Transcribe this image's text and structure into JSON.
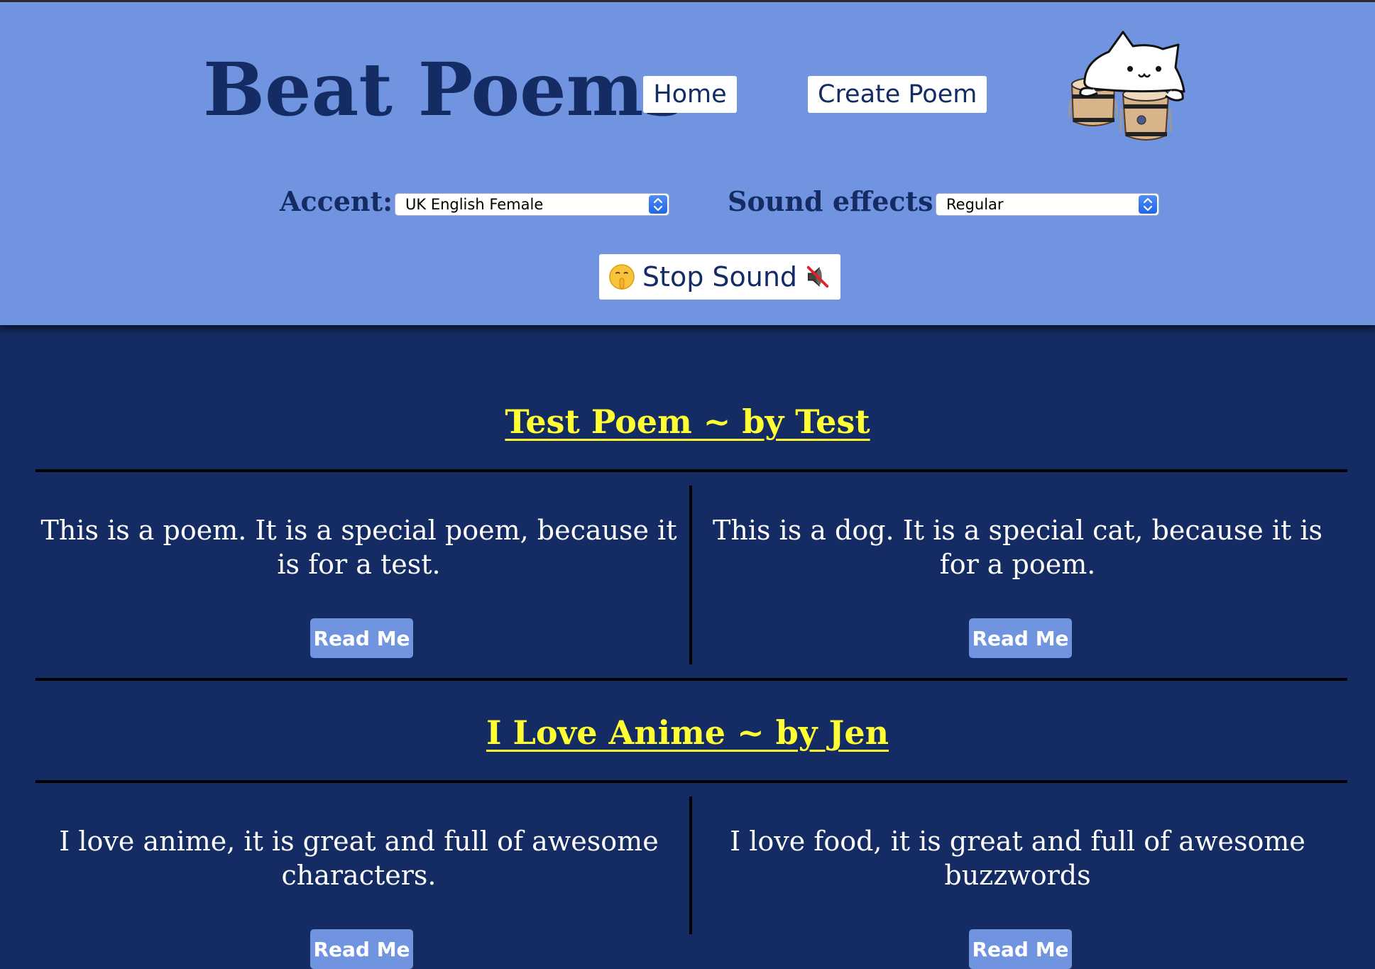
{
  "header": {
    "title": "Beat Poems",
    "nav": {
      "home_label": "Home",
      "create_label": "Create Poem"
    },
    "accent": {
      "label": "Accent:",
      "selected": "UK English Female"
    },
    "sound_effects": {
      "label": "Sound effects:",
      "selected": "Regular"
    },
    "stop_button": {
      "label": "Stop Sound"
    },
    "logo_icon": "bongo-cat-icon"
  },
  "poems": [
    {
      "title": "Test Poem ~ by Test",
      "left_text": "This is a poem. It is a special poem, because it is for a test.",
      "right_text": "This is a dog. It is a special cat, because it is for a poem.",
      "read_label": "Read Me"
    },
    {
      "title": "I Love Anime ~ by Jen",
      "left_text": "I love anime, it is great and full of awesome characters.",
      "right_text": "I love food, it is great and full of awesome buzzwords",
      "read_label": "Read Me"
    }
  ],
  "colors": {
    "header_bg": "#7094e0",
    "page_bg": "#142b63",
    "title_color": "#142b63",
    "poem_title_color": "#ffff33",
    "button_bg": "#7094e0"
  }
}
